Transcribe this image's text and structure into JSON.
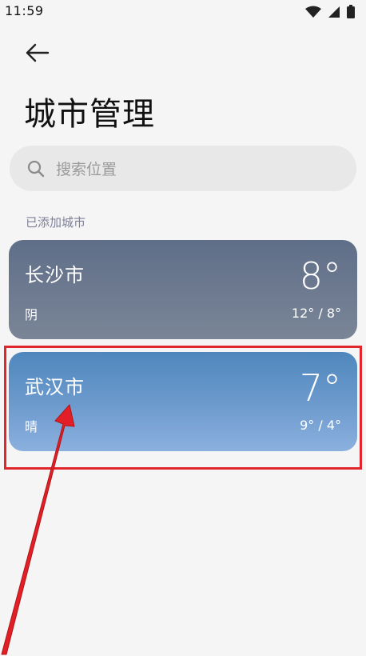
{
  "status_bar": {
    "time": "11:59",
    "icons": [
      "wifi-icon",
      "signal-icon",
      "battery-icon"
    ]
  },
  "header": {
    "back_icon": "arrow-left-icon",
    "title": "城市管理"
  },
  "search": {
    "icon": "search-icon",
    "placeholder": "搜索位置",
    "value": ""
  },
  "section": {
    "label": "已添加城市"
  },
  "cities": [
    {
      "name": "长沙市",
      "condition": "阴",
      "temperature": "8°",
      "range": "12° / 8°",
      "color": "#66748c"
    },
    {
      "name": "武汉市",
      "condition": "晴",
      "temperature": "7°",
      "range": "9° / 4°",
      "color": "#5a8fc6"
    }
  ],
  "annotation": {
    "highlight_color": "#e0262a",
    "target": "武汉市"
  }
}
